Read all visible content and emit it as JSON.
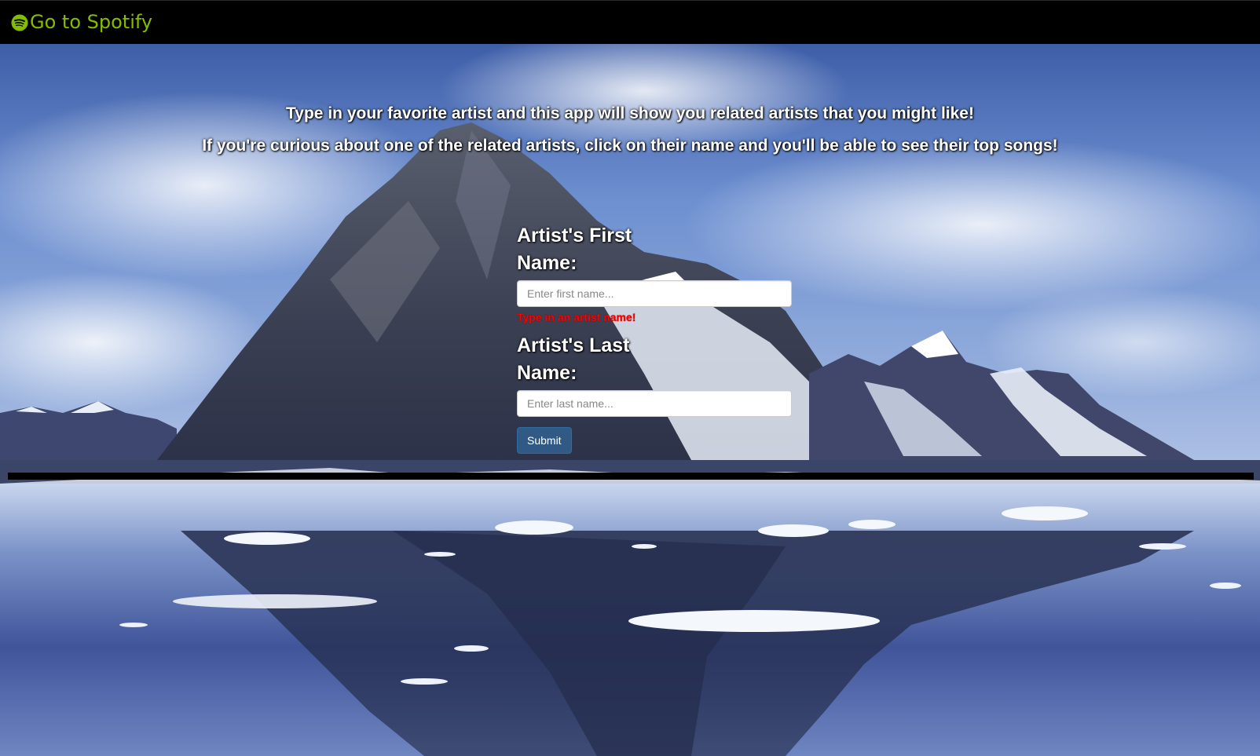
{
  "navbar": {
    "brand_label": "Go to Spotify",
    "brand_icon": "spotify-logo-icon",
    "brand_color": "#84bd00"
  },
  "intro": {
    "line1": "Type in your favorite artist and this app will show you related artists that you might like!",
    "line2": "If you're curious about one of the related artists, click on their name and you'll be able to see their top songs!"
  },
  "form": {
    "first_name": {
      "label": "Artist's First Name:",
      "placeholder": "Enter first name...",
      "value": ""
    },
    "error_message": "Type in an artist name!",
    "last_name": {
      "label": "Artist's Last Name:",
      "placeholder": "Enter last name...",
      "value": ""
    },
    "submit_label": "Submit"
  },
  "colors": {
    "error": "#ff0000",
    "submit": "#337ab7"
  }
}
